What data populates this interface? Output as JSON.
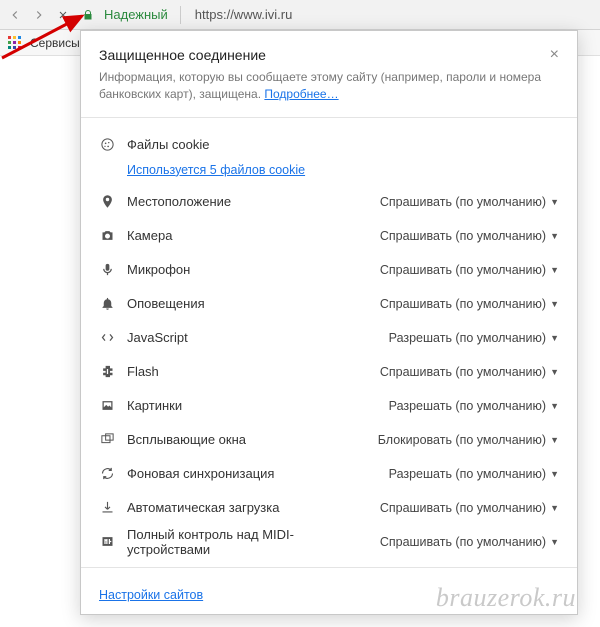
{
  "toolbar": {
    "secure_label": "Надежный",
    "url": "https://www.ivi.ru"
  },
  "bookbar": {
    "services_label": "Сервисы"
  },
  "popup": {
    "title": "Защищенное соединение",
    "desc_prefix": "Информация, которую вы сообщаете этому сайту (например, пароли и номера банковских карт), защищена. ",
    "learn_more": "Подробнее…",
    "cookies": {
      "label": "Файлы cookie",
      "sub": "Используется 5 файлов cookie"
    },
    "perms": [
      {
        "icon": "location",
        "label": "Местоположение",
        "value": "Спрашивать (по умолчанию)"
      },
      {
        "icon": "camera",
        "label": "Камера",
        "value": "Спрашивать (по умолчанию)"
      },
      {
        "icon": "mic",
        "label": "Микрофон",
        "value": "Спрашивать (по умолчанию)"
      },
      {
        "icon": "bell",
        "label": "Оповещения",
        "value": "Спрашивать (по умолчанию)"
      },
      {
        "icon": "js",
        "label": "JavaScript",
        "value": "Разрешать (по умолчанию)"
      },
      {
        "icon": "flash",
        "label": "Flash",
        "value": "Спрашивать (по умолчанию)"
      },
      {
        "icon": "images",
        "label": "Картинки",
        "value": "Разрешать (по умолчанию)"
      },
      {
        "icon": "popup",
        "label": "Всплывающие окна",
        "value": "Блокировать (по умолчанию)"
      },
      {
        "icon": "sync",
        "label": "Фоновая синхронизация",
        "value": "Разрешать (по умолчанию)"
      },
      {
        "icon": "download",
        "label": "Автоматическая загрузка",
        "value": "Спрашивать (по умолчанию)"
      },
      {
        "icon": "midi",
        "label": "Полный контроль над MIDI-устройствами",
        "value": "Спрашивать (по умолчанию)"
      }
    ],
    "site_settings": "Настройки сайтов"
  },
  "watermark": "brauzerok.ru"
}
